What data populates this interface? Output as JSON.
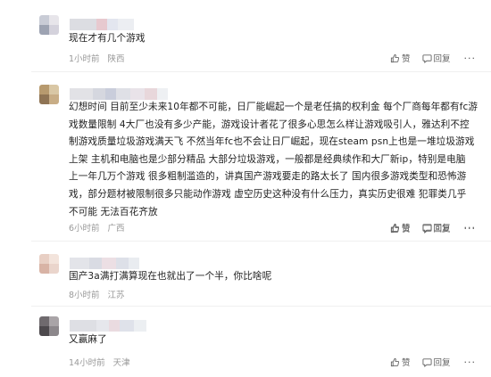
{
  "comments": [
    {
      "text": [
        "现在才有几个游戏"
      ],
      "time": "1小时前",
      "location": "陕西",
      "like_label": "赞",
      "reply_label": "回复",
      "more_label": "···"
    },
    {
      "text": [
        "幻想时间 目前至少未来10年都不可能，日厂能崛起一个是老任搞的权利金 每个厂商每年都有fc游",
        "戏数量限制 4大厂也没有多少产能，游戏设计者花了很多心思怎么样让游戏吸引人，雅达利不控",
        "制游戏质量垃圾游戏满天飞 不然当年fc也不会让日厂崛起，现在steam psn上也是一堆垃圾游戏",
        "上架 主机和电脑也是少部分精品 大部分垃圾游戏，一般都是经典续作和大厂新ip，特别是电脑",
        "上一年几万个游戏 很多粗制滥造的，讲真国产游戏要走的路太长了 国内很多游戏类型和恐怖游",
        "戏，部分题材被限制很多只能动作游戏 虚空历史这种没有什么压力，真实历史很难 犯罪类几乎",
        "不可能 无法百花齐放"
      ],
      "time": "6小时前",
      "location": "广西",
      "like_label": "赞",
      "reply_label": "回复",
      "more_label": "···"
    },
    {
      "text": [
        "国产3a满打满算现在也就出了一个半，你比啥呢"
      ],
      "time": "8小时前",
      "location": "江苏",
      "like_label": "赞",
      "reply_label": "回复",
      "more_label": "···"
    },
    {
      "text": [
        "又赢麻了"
      ],
      "time": "14小时前",
      "location": "天津",
      "like_label": "赞",
      "reply_label": "回复",
      "more_label": "···"
    }
  ],
  "colors": {
    "text": "#222222",
    "meta": "#999999",
    "action": "#666666"
  },
  "icons": {
    "like": "thumbs-up-icon",
    "reply": "comment-bubble-icon",
    "more": "more-dots-icon"
  }
}
